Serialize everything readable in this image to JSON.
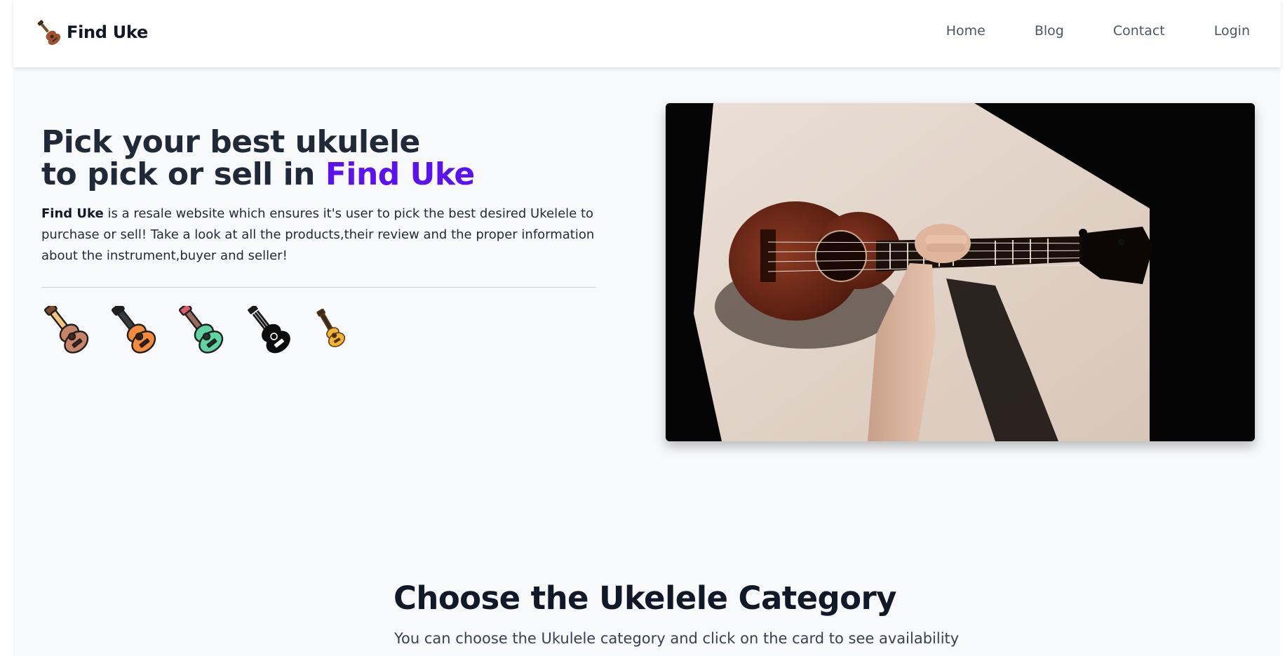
{
  "brand": {
    "name": "Find Uke",
    "icon": "ukulele-logo-icon"
  },
  "nav": {
    "items": [
      {
        "label": "Home"
      },
      {
        "label": "Blog"
      },
      {
        "label": "Contact"
      },
      {
        "label": "Login"
      }
    ]
  },
  "hero": {
    "title_line1": "Pick your best ukulele",
    "title_line2_prefix": "to pick or sell in ",
    "title_accent": "Find Uke",
    "desc_bold": "Find Uke",
    "desc_rest": " is a resale website which ensures it's user to pick the best desired Ukelele to purchase or sell! Take a look at all the products,their review and the proper information about the instrument,buyer and seller!",
    "image": "ukulele-photo"
  },
  "uke_icons": [
    "brown-ukulele-icon",
    "orange-ukulele-icon",
    "green-ukulele-icon",
    "black-ukulele-icon",
    "yellow-ukulele-icon"
  ],
  "category": {
    "title": "Choose the Ukelele Category",
    "subtitle": "You can choose the Ukulele category and click on the card to see availability"
  },
  "colors": {
    "accent": "#5b12f2",
    "background": "#f8f9fb",
    "text": "#1f2937"
  }
}
